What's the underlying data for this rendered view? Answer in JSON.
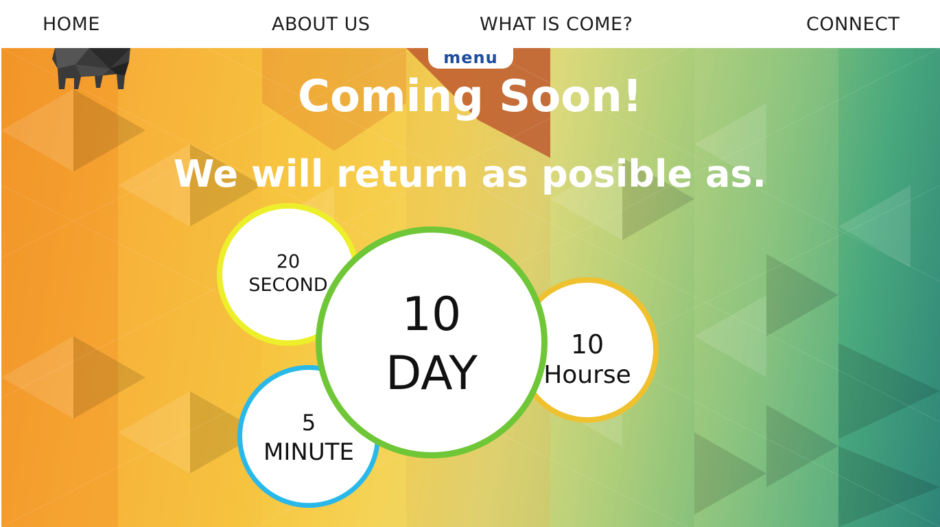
{
  "nav": {
    "items": [
      {
        "label": "HOME"
      },
      {
        "label": "ABOUT US"
      },
      {
        "label": "WHAT IS COME?"
      },
      {
        "label": "CONNECT"
      }
    ],
    "menu_tab": "menu"
  },
  "hero": {
    "title": "Coming Soon!",
    "subtitle": "We will return as posible as."
  },
  "countdown": {
    "seconds": {
      "value": "20",
      "unit": "SECOND"
    },
    "days": {
      "value": "10",
      "unit": "DAY"
    },
    "hours": {
      "value": "10",
      "unit": "Hourse"
    },
    "minutes": {
      "value": "5",
      "unit": "MINUTE"
    }
  },
  "colors": {
    "seconds_ring": "#ecef2a",
    "days_ring": "#6fc637",
    "hours_ring": "#efc12e",
    "minutes_ring": "#29b8ea",
    "menu_text": "#1e4d9c"
  },
  "logo": {
    "icon": "elephant-icon"
  }
}
